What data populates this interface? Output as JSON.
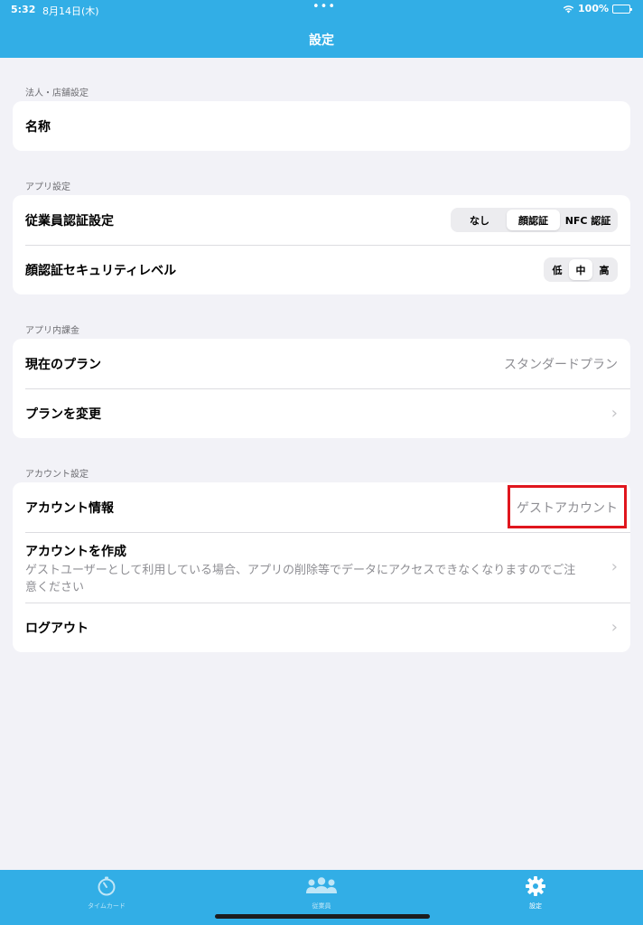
{
  "status_bar": {
    "time": "5:32",
    "date": "8月14日(木)",
    "battery": "100%"
  },
  "nav": {
    "title": "設定"
  },
  "sections": {
    "corporate": {
      "header": "法人・店舗設定",
      "name_label": "名称"
    },
    "app": {
      "header": "アプリ設定",
      "auth_label": "従業員認証設定",
      "auth_options": [
        "なし",
        "顔認証",
        "NFC 認証"
      ],
      "auth_selected": "顔認証",
      "security_label": "顔認証セキュリティレベル",
      "security_options": [
        "低",
        "中",
        "高"
      ],
      "security_selected": "中"
    },
    "billing": {
      "header": "アプリ内課金",
      "plan_label": "現在のプラン",
      "plan_value": "スタンダードプラン",
      "change_label": "プランを変更"
    },
    "account": {
      "header": "アカウント設定",
      "info_label": "アカウント情報",
      "info_value": "ゲストアカウント",
      "create_label": "アカウントを作成",
      "create_desc": "ゲストユーザーとして利用している場合、アプリの削除等でデータにアクセスできなくなりますのでご注意ください",
      "logout_label": "ログアウト"
    }
  },
  "tabbar": {
    "items": [
      {
        "label": "タイムカード",
        "icon": "timer-icon"
      },
      {
        "label": "従業員",
        "icon": "people-icon"
      },
      {
        "label": "設定",
        "icon": "gear-icon"
      }
    ],
    "active": "設定"
  },
  "colors": {
    "brand": "#32aee6",
    "highlight": "#e0161e"
  }
}
